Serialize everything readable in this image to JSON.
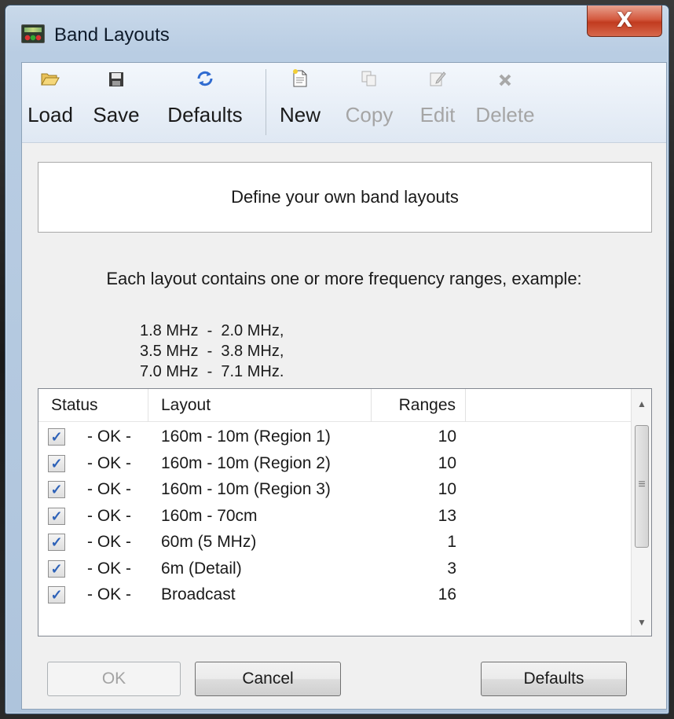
{
  "window": {
    "title": "Band Layouts",
    "close_glyph": "X"
  },
  "toolbar": {
    "load": {
      "label": "Load",
      "icon": "folder-open-icon"
    },
    "save": {
      "label": "Save",
      "icon": "floppy-disk-icon"
    },
    "defaults": {
      "label": "Defaults",
      "icon": "refresh-icon"
    },
    "new": {
      "label": "New",
      "icon": "new-document-icon"
    },
    "copy": {
      "label": "Copy",
      "icon": "copy-icon",
      "disabled": true
    },
    "edit": {
      "label": "Edit",
      "icon": "edit-icon",
      "disabled": true
    },
    "delete": {
      "label": "Delete",
      "icon": "delete-x-icon",
      "disabled": true
    }
  },
  "panel": {
    "heading": "Define your own band layouts"
  },
  "description": "Each layout contains one or more frequency ranges, example:",
  "examples": [
    "1.8 MHz  -  2.0 MHz,",
    "3.5 MHz  -  3.8 MHz,",
    "7.0 MHz  -  7.1 MHz."
  ],
  "list": {
    "columns": {
      "status": "Status",
      "layout": "Layout",
      "ranges": "Ranges"
    },
    "rows": [
      {
        "checked": true,
        "status": "- OK -",
        "layout": "160m - 10m (Region 1)",
        "ranges": "10"
      },
      {
        "checked": true,
        "status": "- OK -",
        "layout": "160m - 10m (Region 2)",
        "ranges": "10"
      },
      {
        "checked": true,
        "status": "- OK -",
        "layout": "160m - 10m (Region 3)",
        "ranges": "10"
      },
      {
        "checked": true,
        "status": "- OK -",
        "layout": "160m - 70cm",
        "ranges": "13"
      },
      {
        "checked": true,
        "status": "- OK -",
        "layout": "60m (5 MHz)",
        "ranges": "1"
      },
      {
        "checked": true,
        "status": "- OK -",
        "layout": "6m (Detail)",
        "ranges": "3"
      },
      {
        "checked": true,
        "status": "- OK -",
        "layout": "Broadcast",
        "ranges": "16"
      }
    ]
  },
  "buttons": {
    "ok": "OK",
    "cancel": "Cancel",
    "defaults": "Defaults"
  },
  "colors": {
    "checkmark": "#2e62b8",
    "disabled_text": "#a5a5a5",
    "close_button": "#c13b1f"
  }
}
